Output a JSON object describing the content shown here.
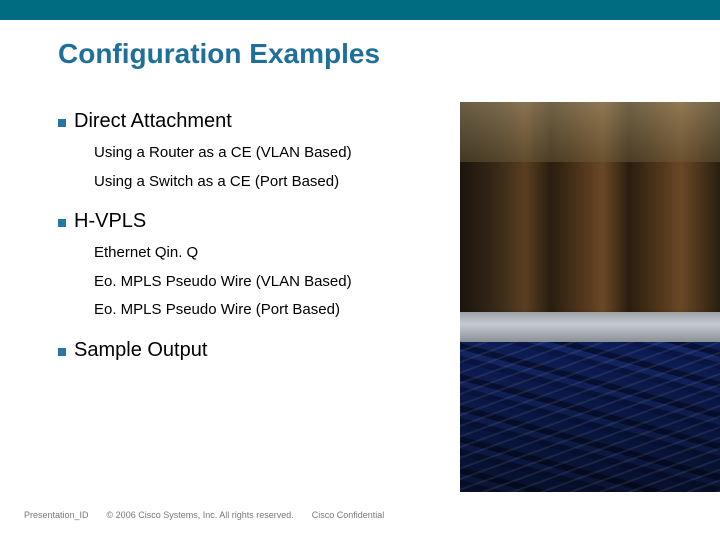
{
  "title": "Configuration Examples",
  "sections": [
    {
      "heading": "Direct Attachment",
      "items": [
        "Using a Router as a CE (VLAN Based)",
        "Using a Switch as a CE (Port Based)"
      ]
    },
    {
      "heading": "H-VPLS",
      "items": [
        "Ethernet Qin. Q",
        "Eo. MPLS Pseudo Wire (VLAN Based)",
        "Eo. MPLS Pseudo Wire (Port Based)"
      ]
    },
    {
      "heading": "Sample Output",
      "items": []
    }
  ],
  "footer": {
    "presentation_id": "Presentation_ID",
    "copyright": "© 2006 Cisco Systems, Inc. All rights reserved.",
    "confidential": "Cisco Confidential"
  }
}
